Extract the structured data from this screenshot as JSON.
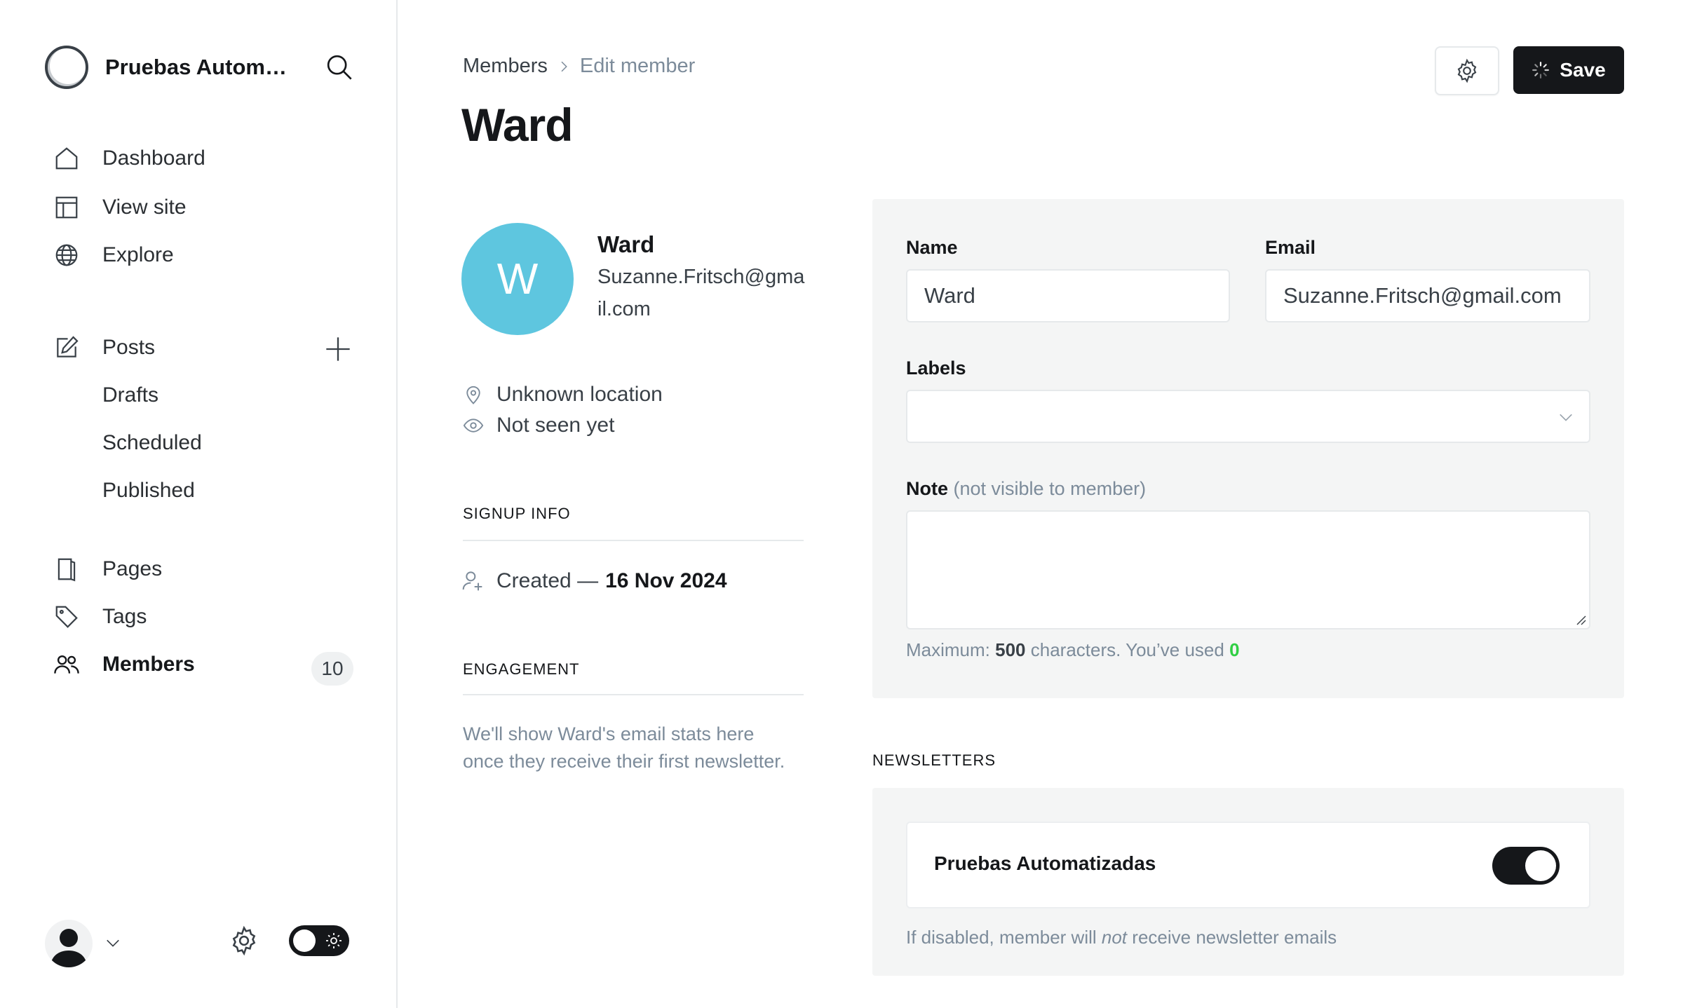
{
  "site": {
    "title": "Pruebas Automatizadas"
  },
  "nav": {
    "dashboard": "Dashboard",
    "view_site": "View site",
    "explore": "Explore",
    "posts": "Posts",
    "drafts": "Drafts",
    "scheduled": "Scheduled",
    "published": "Published",
    "pages": "Pages",
    "tags": "Tags",
    "members": "Members",
    "members_count": "10"
  },
  "breadcrumb": {
    "parent": "Members",
    "current": "Edit member"
  },
  "header": {
    "title": "Ward",
    "save_label": "Save"
  },
  "member": {
    "initial": "W",
    "name": "Ward",
    "email": "Suzanne.Fritsch@gmail.com",
    "location": "Unknown location",
    "seen": "Not seen yet",
    "avatar_color": "#5ec6df"
  },
  "signup": {
    "heading": "SIGNUP INFO",
    "created_prefix": "Created —",
    "created_date": "16 Nov 2024"
  },
  "engagement": {
    "heading": "ENGAGEMENT",
    "text": "We'll show Ward's email stats here once they receive their first newsletter."
  },
  "form": {
    "name_label": "Name",
    "name_value": "Ward",
    "email_label": "Email",
    "email_value": "Suzanne.Fritsch@gmail.com",
    "labels_label": "Labels",
    "labels_value": "",
    "note_label": "Note",
    "note_sub": "(not visible to member)",
    "note_value": "",
    "hint_prefix": "Maximum:",
    "hint_max": "500",
    "hint_middle": "characters. You’ve used",
    "hint_used": "0"
  },
  "newsletters": {
    "heading": "NEWSLETTERS",
    "items": [
      {
        "name": "Pruebas Automatizadas",
        "subscribed": true
      }
    ],
    "hint_before": "If disabled, member will",
    "hint_em": "not",
    "hint_after": "receive newsletter emails"
  },
  "colors": {
    "accent_dark": "#15171a",
    "used_count": "#30cf43",
    "panel_bg": "#f4f5f5"
  }
}
